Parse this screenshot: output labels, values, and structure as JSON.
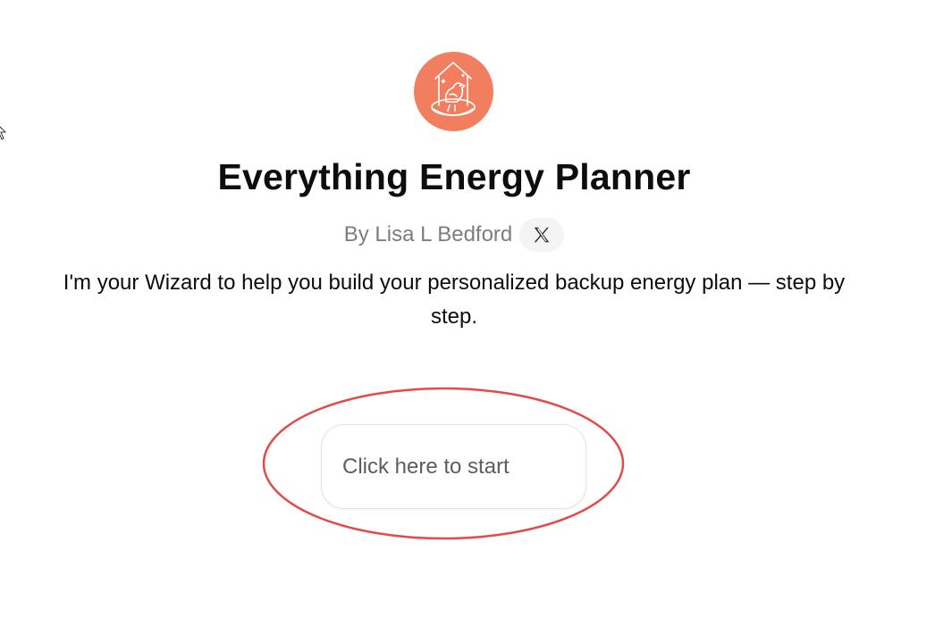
{
  "app": {
    "title": "Everything Energy Planner",
    "author": "By Lisa L Bedford",
    "social_icon": "x-logo-icon",
    "logo_icon": "birdhouse-icon"
  },
  "intro": {
    "description": "I'm your Wizard to help you build your personalized backup energy plan — step by step."
  },
  "start": {
    "label": "Click here to start"
  },
  "colors": {
    "logo_bg": "#f17e5e",
    "highlight_ring": "#e44a4a",
    "muted_text": "#7d7d7d"
  }
}
